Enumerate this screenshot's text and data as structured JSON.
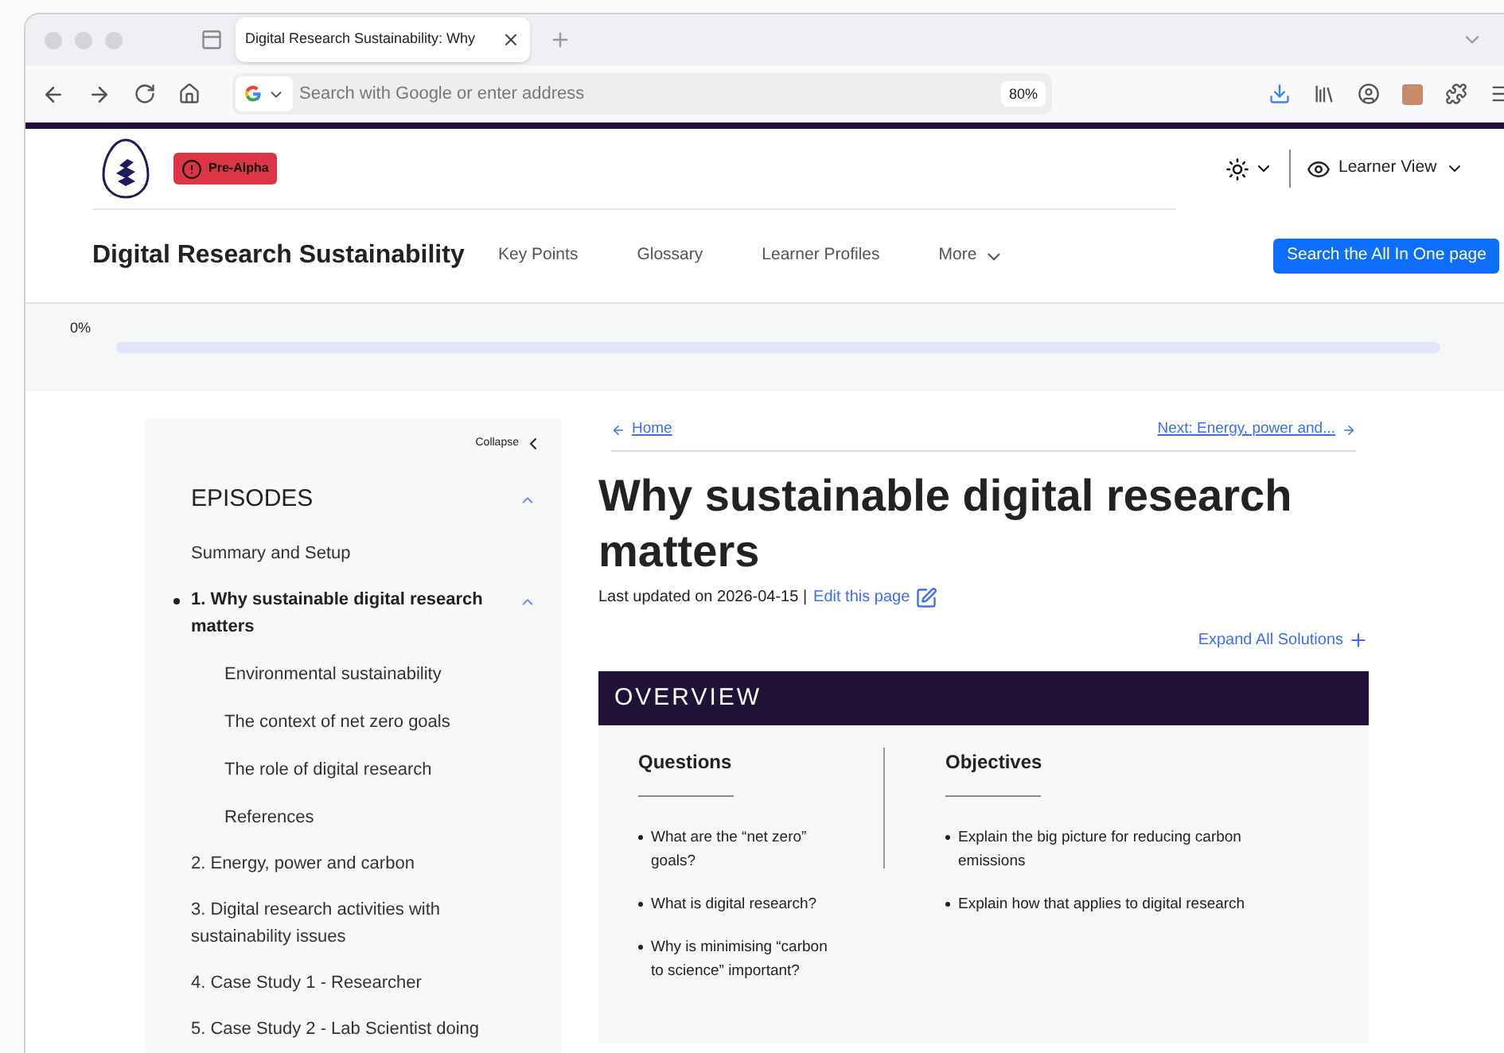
{
  "browser": {
    "tab_title": "Digital Research Sustainability: Why",
    "address_placeholder": "Search with Google or enter address",
    "zoom": "80%"
  },
  "header": {
    "badge": "Pre-Alpha",
    "view": "Learner View",
    "site_title": "Digital Research Sustainability",
    "nav": [
      {
        "label": "Key Points",
        "menu": false
      },
      {
        "label": "Glossary",
        "menu": false
      },
      {
        "label": "Learner Profiles",
        "menu": false
      },
      {
        "label": "More",
        "menu": true
      }
    ],
    "search_button": "Search the All In One page"
  },
  "progress": {
    "reading": "0%",
    "level": 0
  },
  "sidebar": {
    "collapse": "Collapse",
    "heading": "EPISODES",
    "expanded": true,
    "items": [
      {
        "label": "Summary and Setup",
        "selected": false
      },
      {
        "label": "1. Why sustainable digital research matters",
        "selected": true,
        "expanded": true,
        "children": [
          {
            "label": "Environmental sustainability"
          },
          {
            "label": "The context of net zero goals"
          },
          {
            "label": "The role of digital research"
          },
          {
            "label": "References"
          }
        ]
      },
      {
        "label": "2. Energy, power and carbon",
        "selected": false
      },
      {
        "label": "3. Digital research activities with sustainability issues",
        "selected": false
      },
      {
        "label": "4. Case Study 1 - Researcher",
        "selected": false
      },
      {
        "label": "5. Case Study 2 - Lab Scientist doing",
        "selected": false
      }
    ]
  },
  "main": {
    "prev": "Home",
    "next": "Next: Energy, power and...",
    "title": "Why sustainable digital research matters",
    "updated": "Last updated on 2026-04-15 |",
    "edit": "Edit this page",
    "expand_all": "Expand All Solutions",
    "overview": {
      "heading": "OVERVIEW",
      "columns": [
        {
          "heading": "Questions",
          "items": [
            "What are the “net zero” goals?",
            "What is digital research?",
            "Why is minimising “carbon to science” important?"
          ]
        },
        {
          "heading": "Objectives",
          "items": [
            "Explain the big picture for reducing carbon emissions",
            "Explain how that applies to digital research"
          ]
        }
      ]
    }
  }
}
